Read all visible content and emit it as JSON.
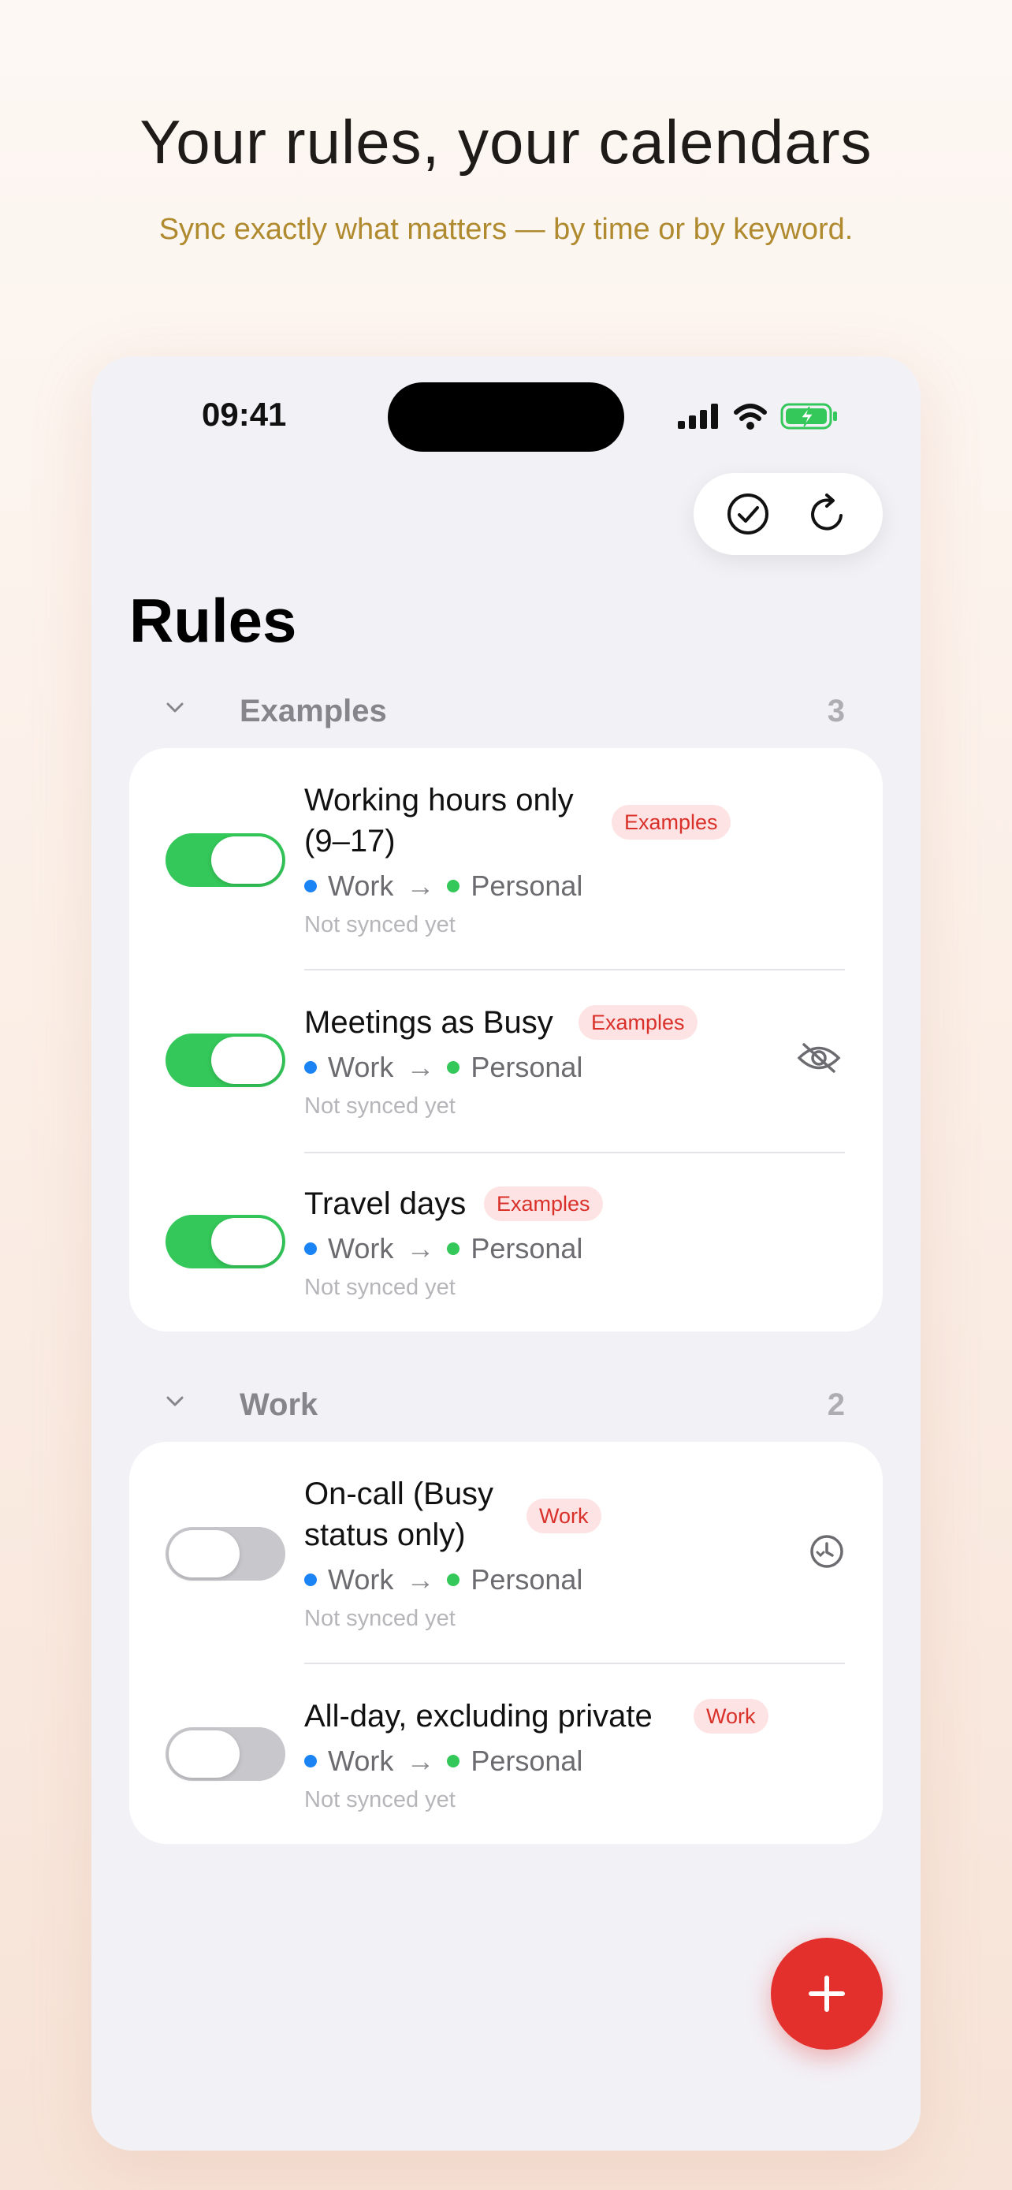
{
  "promo": {
    "headline": "Your rules, your calendars",
    "subheadline": "Sync exactly what matters — by time or by keyword."
  },
  "status_bar": {
    "time": "09:41",
    "icons": [
      "signal-icon",
      "wifi-icon",
      "battery-charging-icon"
    ]
  },
  "toolbar": {
    "icons": [
      "checkmark-circle-icon",
      "refresh-icon"
    ]
  },
  "page_title": "Rules",
  "sections": [
    {
      "label": "Examples",
      "count": "3",
      "rules": [
        {
          "title_line1": "Working hours only",
          "title_line2": "(9–17)",
          "tag": "Examples",
          "enabled": true,
          "from": "Work",
          "arrow": "→",
          "to": "Personal",
          "sync_status": "Not synced yet"
        },
        {
          "title": "Meetings as Busy",
          "tag": "Examples",
          "enabled": true,
          "from": "Work",
          "arrow": "→",
          "to": "Personal",
          "sync_status": "Not synced yet",
          "icon": "eye-slash-icon"
        },
        {
          "title": "Travel days",
          "tag": "Examples",
          "enabled": true,
          "from": "Work",
          "arrow": "→",
          "to": "Personal",
          "sync_status": "Not synced yet"
        }
      ]
    },
    {
      "label": "Work",
      "count": "2",
      "rules": [
        {
          "title_line1": "On-call (Busy",
          "title_line2": "status only)",
          "tag": "Work",
          "enabled": false,
          "from": "Work",
          "arrow": "→",
          "to": "Personal",
          "sync_status": "Not synced yet",
          "icon": "history-icon"
        },
        {
          "title": "All-day, excluding private",
          "tag": "Work",
          "enabled": false,
          "from": "Work",
          "arrow": "→",
          "to": "Personal",
          "sync_status": "Not synced yet"
        }
      ]
    }
  ],
  "colors": {
    "work_dot": "#1a84f5",
    "personal_dot": "#34c759",
    "accent": "#e3302d",
    "toggle_on": "#34c759"
  },
  "fab": {
    "icon": "plus-icon"
  }
}
